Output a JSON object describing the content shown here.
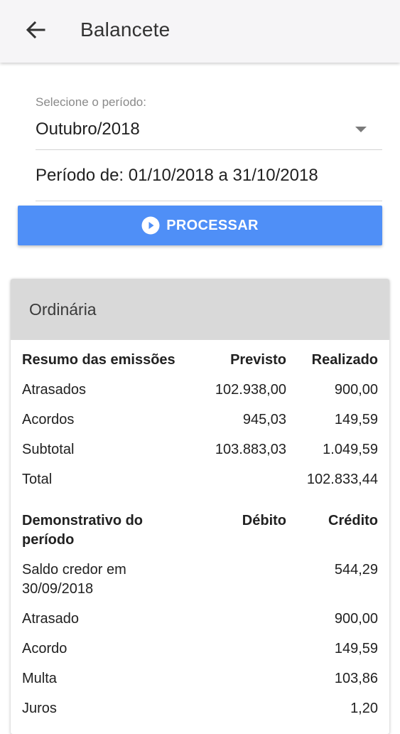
{
  "appbar": {
    "title": "Balancete"
  },
  "period": {
    "label": "Selecione o período:",
    "selected": "Outubro/2018",
    "range": "Período de: 01/10/2018 a 31/10/2018"
  },
  "process_button": {
    "label": "PROCESSAR"
  },
  "card": {
    "title": "Ordinária",
    "summary": {
      "headers": [
        "Resumo das emissões",
        "Previsto",
        "Realizado"
      ],
      "rows": [
        [
          "Atrasados",
          "102.938,00",
          "900,00"
        ],
        [
          "Acordos",
          "945,03",
          "149,59"
        ],
        [
          "Subtotal",
          "103.883,03",
          "1.049,59"
        ],
        [
          "Total",
          "",
          "102.833,44"
        ]
      ]
    },
    "statement": {
      "headers": [
        "Demonstrativo do período",
        "Débito",
        "Crédito"
      ],
      "rows": [
        [
          "Saldo credor em 30/09/2018",
          "",
          "544,29"
        ],
        [
          "Atrasado",
          "",
          "900,00"
        ],
        [
          "Acordo",
          "",
          "149,59"
        ],
        [
          "Multa",
          "",
          "103,86"
        ],
        [
          "Juros",
          "",
          "1,20"
        ]
      ]
    }
  },
  "colors": {
    "appbar_bg": "#f6f5f7",
    "primary": "#4f8ff7",
    "card_header_bg": "#d9d9d9"
  },
  "icons": {
    "back": "arrow-left-icon",
    "dropdown": "caret-down-icon",
    "process": "play-circle-icon"
  }
}
